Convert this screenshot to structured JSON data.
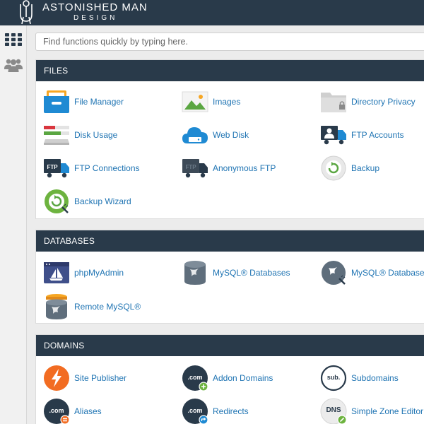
{
  "brand": {
    "line1": "ASTONISHED MAN",
    "line2": "DESIGN"
  },
  "search": {
    "placeholder": "Find functions quickly by typing here."
  },
  "sidebar": {
    "items": [
      {
        "icon": "grid-icon"
      },
      {
        "icon": "users-icon"
      }
    ]
  },
  "colors": {
    "header": "#293a4a",
    "link": "#1f74b3",
    "accent_green": "#6db33f",
    "accent_orange": "#f26c22"
  },
  "sections": {
    "files": {
      "title": "FILES",
      "items": [
        {
          "label": "File Manager",
          "icon": "file-manager-icon"
        },
        {
          "label": "Images",
          "icon": "images-icon"
        },
        {
          "label": "Directory Privacy",
          "icon": "directory-privacy-icon"
        },
        {
          "label": "Disk Usage",
          "icon": "disk-usage-icon"
        },
        {
          "label": "Web Disk",
          "icon": "web-disk-icon"
        },
        {
          "label": "FTP Accounts",
          "icon": "ftp-accounts-icon"
        },
        {
          "label": "FTP Connections",
          "icon": "ftp-connections-icon"
        },
        {
          "label": "Anonymous FTP",
          "icon": "anonymous-ftp-icon"
        },
        {
          "label": "Backup",
          "icon": "backup-icon"
        },
        {
          "label": "Backup Wizard",
          "icon": "backup-wizard-icon"
        }
      ]
    },
    "databases": {
      "title": "DATABASES",
      "items": [
        {
          "label": "phpMyAdmin",
          "icon": "phpmyadmin-icon"
        },
        {
          "label": "MySQL® Databases",
          "icon": "mysql-databases-icon"
        },
        {
          "label": "MySQL® Database W",
          "icon": "mysql-database-wizard-icon"
        },
        {
          "label": "Remote MySQL®",
          "icon": "remote-mysql-icon"
        }
      ]
    },
    "domains": {
      "title": "DOMAINS",
      "items": [
        {
          "label": "Site Publisher",
          "icon": "site-publisher-icon"
        },
        {
          "label": "Addon Domains",
          "icon": "addon-domains-icon",
          "badge": ".com"
        },
        {
          "label": "Subdomains",
          "icon": "subdomains-icon",
          "badge": "sub."
        },
        {
          "label": "Aliases",
          "icon": "aliases-icon",
          "badge": ".com"
        },
        {
          "label": "Redirects",
          "icon": "redirects-icon",
          "badge": ".com"
        },
        {
          "label": "Simple Zone Editor",
          "icon": "simple-zone-editor-icon",
          "badge": "DNS"
        }
      ]
    }
  }
}
